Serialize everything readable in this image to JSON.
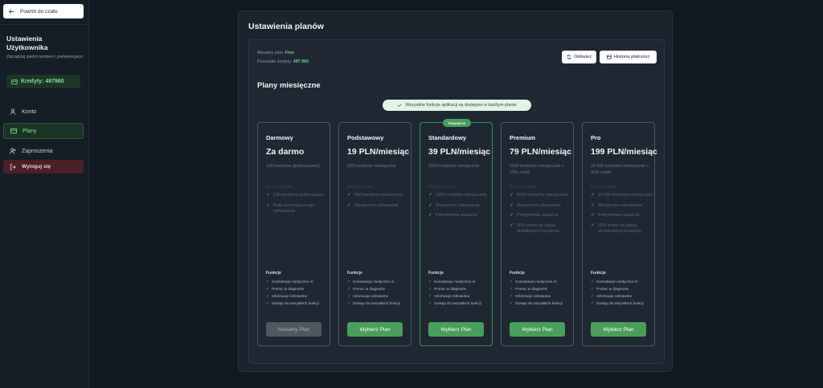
{
  "sidebar": {
    "back_label": "Powrót do czatu",
    "title": "Ustawienia Użytkownika",
    "subtitle": "Zarządzaj swoim kontem i preferencjami",
    "credits_label": "Kredyty: 497960",
    "nav": {
      "konto": "Konto",
      "plany": "Plany",
      "zaproszenia": "Zaproszenia",
      "logout": "Wyloguj się"
    }
  },
  "main": {
    "title": "Ustawienia planów",
    "current_plan_label": "Aktualny plan: ",
    "current_plan_value": "Free",
    "remaining_label": "Pozostałe kredyty: ",
    "remaining_value": "497 960",
    "refresh_label": "Odśwież",
    "history_label": "Historia płatności",
    "section_title": "Plany miesięczne",
    "info_pill": "Wszystkie funkcje aplikacji są dostępne w każdym planie"
  },
  "plans": [
    {
      "name": "Darmowy",
      "price": "Za darmo",
      "desc": "100 kredytów (jednorazowo)",
      "section": "Korzyści planu:",
      "features": [
        "100 kredytów jednorazowo",
        "Brak automatycznego odnowienia"
      ],
      "funkcje_title": "Funkcje",
      "funkcje": [
        "Konsultacje medyczne AI",
        "Pomoc w diagnozie",
        "Informacje zdrowotne",
        "Dostęp do wszystkich funkcji"
      ],
      "button": "Aktualny Plan",
      "popular": false
    },
    {
      "name": "Podstawowy",
      "price": "19 PLN/miesiąc",
      "desc": "500 kredytów miesięcznie",
      "section": "Korzyści planu:",
      "features": [
        "500 kredytów miesięcznie",
        "Miesięczne odnawianie"
      ],
      "funkcje_title": "Funkcje",
      "funkcje": [
        "Konsultacje medyczne AI",
        "Pomoc w diagnozie",
        "Informacje zdrowotne",
        "Dostęp do wszystkich funkcji"
      ],
      "button": "Wybierz Plan",
      "popular": false
    },
    {
      "name": "Standardowy",
      "price": "39 PLN/miesiąc",
      "desc": "1500 kredytów miesięcznie",
      "section": "Korzyści planu:",
      "features": [
        "1500 kredytów miesięcznie",
        "Miesięczne odnawianie",
        "Priorytetowe wsparcie"
      ],
      "funkcje_title": "Funkcje",
      "funkcje": [
        "Konsultacje medyczne AI",
        "Pomoc w diagnozie",
        "Informacje zdrowotne",
        "Dostęp do wszystkich funkcji"
      ],
      "button": "Wybierz Plan",
      "popular": true,
      "badge": "Popularne"
    },
    {
      "name": "Premium",
      "price": "79 PLN/miesiąc",
      "desc": "5000 kredytów miesięcznie + 20% zniżki",
      "section": "Korzyści planu:",
      "features": [
        "5000 kredytów miesięcznie",
        "Miesięczne odnawianie",
        "Priorytetowe wsparcie",
        "20% zniżki na zakup dodatkowych kredytów"
      ],
      "funkcje_title": "Funkcje",
      "funkcje": [
        "Konsultacje medyczne AI",
        "Pomoc w diagnozie",
        "Informacje zdrowotne",
        "Dostęp do wszystkich funkcji"
      ],
      "button": "Wybierz Plan",
      "popular": false
    },
    {
      "name": "Pro",
      "price": "199 PLN/miesiąc",
      "desc": "15 000 kredytów miesięcznie + 30% zniżki",
      "section": "Korzyści planu:",
      "features": [
        "15 000 kredytów miesięcznie",
        "Miesięczne odnawianie",
        "Priorytetowe wsparcie",
        "30% zniżki na zakup dodatkowych kredytów"
      ],
      "funkcje_title": "Funkcje",
      "funkcje": [
        "Konsultacje medyczne AI",
        "Pomoc w diagnozie",
        "Informacje zdrowotne",
        "Dostęp do wszystkich funkcji"
      ],
      "button": "Wybierz Plan",
      "popular": false
    }
  ],
  "colors": {
    "accent": "#4a9e5c",
    "background": "#111821",
    "panel": "#1b232d"
  }
}
